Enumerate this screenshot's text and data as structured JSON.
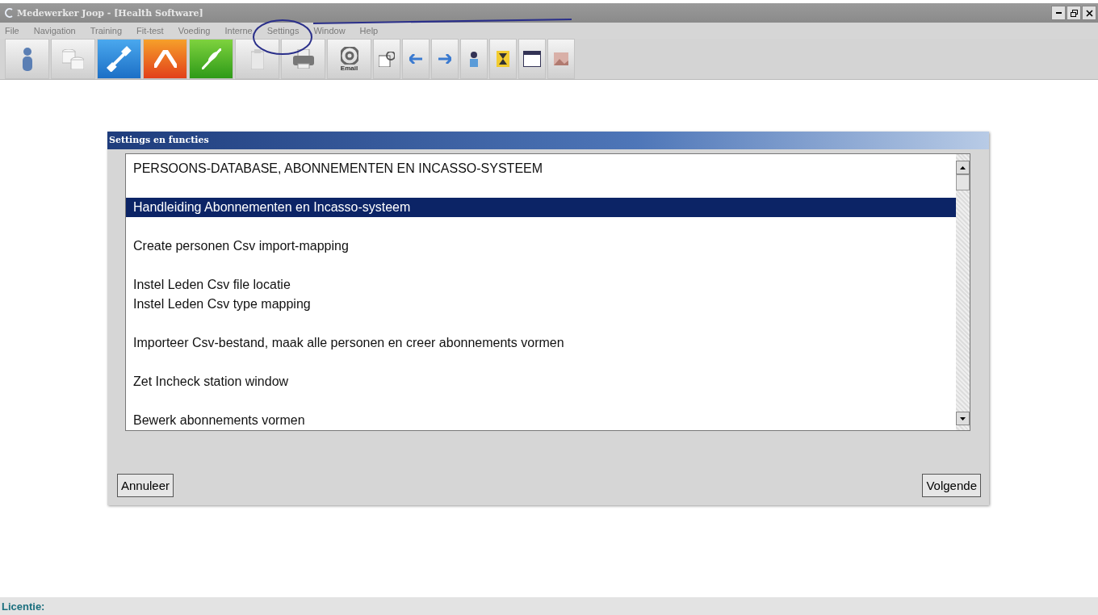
{
  "window": {
    "title": "Medewerker Joop - [Health Software]"
  },
  "menu": [
    {
      "label": "File",
      "disabled": true
    },
    {
      "label": "Navigation",
      "disabled": true
    },
    {
      "label": "Training",
      "disabled": true
    },
    {
      "label": "Fit-test",
      "disabled": true
    },
    {
      "label": "Voeding",
      "disabled": true
    },
    {
      "label": "Interne",
      "disabled": true
    },
    {
      "label": "Settings",
      "disabled": true
    },
    {
      "label": "Window",
      "disabled": true
    },
    {
      "label": "Help",
      "disabled": true
    }
  ],
  "toolbar": {
    "email_label": "Email"
  },
  "dialog": {
    "title": "Settings en functies",
    "groups": [
      {
        "lines": [
          {
            "text": "PERSOONS-DATABASE, ABONNEMENTEN EN INCASSO-SYSTEEM",
            "selected": false
          }
        ]
      },
      {
        "lines": [
          {
            "text": "Handleiding Abonnementen en Incasso-systeem",
            "selected": true
          }
        ]
      },
      {
        "lines": [
          {
            "text": "Create personen Csv import-mapping",
            "selected": false
          }
        ]
      },
      {
        "lines": [
          {
            "text": "Instel Leden Csv file locatie",
            "selected": false
          },
          {
            "text": "Instel Leden Csv type mapping",
            "selected": false
          }
        ]
      },
      {
        "lines": [
          {
            "text": "Importeer Csv-bestand, maak alle personen en creer abonnements vormen",
            "selected": false
          }
        ]
      },
      {
        "lines": [
          {
            "text": "Zet Incheck station window",
            "selected": false
          }
        ]
      },
      {
        "lines": [
          {
            "text": "Bewerk abonnements vormen",
            "selected": false
          }
        ]
      }
    ],
    "buttons": [
      {
        "label": "Annuleer"
      },
      {
        "label": "Volgende"
      }
    ]
  },
  "status_bar": {
    "label": "Licentie:"
  }
}
